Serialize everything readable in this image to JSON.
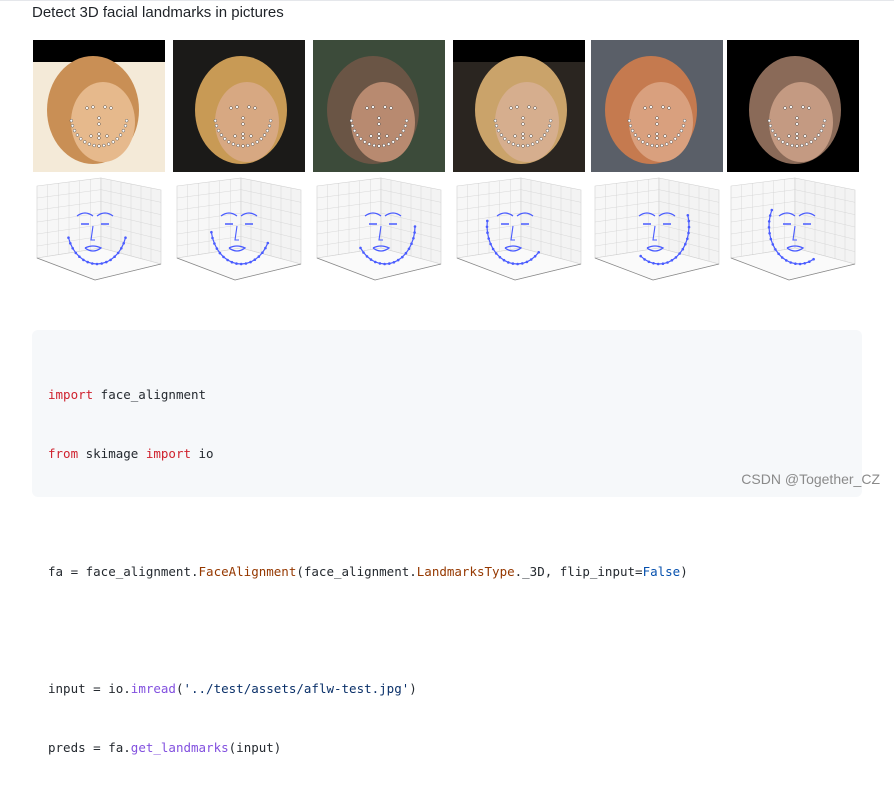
{
  "heading": "Detect 3D facial landmarks in pictures",
  "photos": [
    {
      "name": "face-photo-1",
      "palette": [
        "#f4ead8",
        "#c98f55",
        "#e6b98c"
      ]
    },
    {
      "name": "face-photo-2",
      "palette": [
        "#1b1a18",
        "#c89a55",
        "#d7a882"
      ]
    },
    {
      "name": "face-photo-3",
      "palette": [
        "#3c4b3a",
        "#6a5545",
        "#b88a70"
      ]
    },
    {
      "name": "face-photo-4",
      "palette": [
        "#2a2520",
        "#caa36a",
        "#d6ae8e"
      ]
    },
    {
      "name": "face-photo-5",
      "palette": [
        "#5a5f68",
        "#c57a4f",
        "#d9a07e"
      ]
    },
    {
      "name": "face-photo-6",
      "palette": [
        "#000000",
        "#8a6a58",
        "#c49a82"
      ]
    }
  ],
  "landmark_color": "#4a5cff",
  "code": {
    "line1": {
      "kw1": "import",
      "rest": " face_alignment"
    },
    "line2": {
      "kw1": "from",
      "mid": " skimage ",
      "kw2": "import",
      "rest": " io"
    },
    "line4": {
      "a": "fa = face_alignment.",
      "cls": "FaceAlignment",
      "b": "(face_alignment.",
      "cls2": "LandmarksType",
      "c": "._3D, flip_input=",
      "val": "False",
      "d": ")"
    },
    "line6": {
      "a": "input = io.",
      "fn": "imread",
      "b": "(",
      "str": "'../test/assets/aflw-test.jpg'",
      "c": ")"
    },
    "line7": {
      "a": "preds = fa.",
      "fn": "get_landmarks",
      "b": "(input)"
    }
  },
  "watermark": "CSDN @Together_CZ"
}
